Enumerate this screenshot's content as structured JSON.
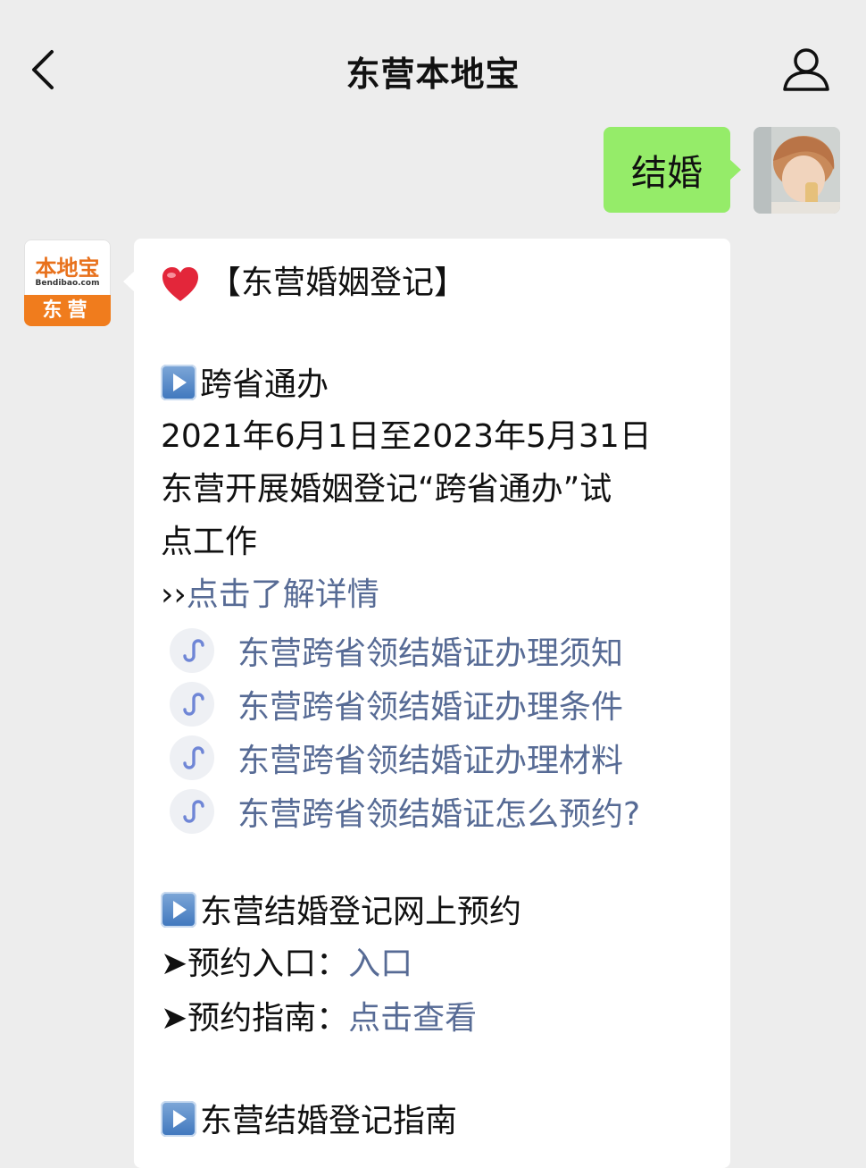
{
  "header": {
    "title": "东营本地宝"
  },
  "outgoing_message": {
    "text": "结婚"
  },
  "bot_avatar": {
    "logo_text": "本地宝",
    "domain_text": "Bendibao.com",
    "city_text": "东营"
  },
  "reply": {
    "title": "【东营婚姻登记】",
    "section1": {
      "heading": "跨省通办",
      "line1": "2021年6月1日至2023年5月31日",
      "line2": "东营开展婚姻登记“跨省通办”试",
      "line3": "点工作",
      "more_prefix": "››",
      "more_link": "点击了解详情",
      "mini_links": [
        "东营跨省领结婚证办理须知",
        "东营跨省领结婚证办理条件",
        "东营跨省领结婚证办理材料",
        "东营跨省领结婚证怎么预约?"
      ]
    },
    "section2": {
      "heading": "东营结婚登记网上预约",
      "entry_label": "➤预约入口：",
      "entry_link": "入口",
      "guide_label": "➤预约指南：",
      "guide_link": "点击查看"
    },
    "section3": {
      "heading": "东营结婚登记指南"
    }
  },
  "icons": {
    "back": "chevron-left-icon",
    "profile": "person-icon",
    "heart": "red-heart-icon",
    "play": "play-button-icon",
    "mini_program": "mini-program-link-icon"
  },
  "colors": {
    "background": "#ededed",
    "outgoing_bubble": "#95ec69",
    "link": "#576b95",
    "brand_orange": "#f07c1d",
    "heart": "#e3263a"
  }
}
